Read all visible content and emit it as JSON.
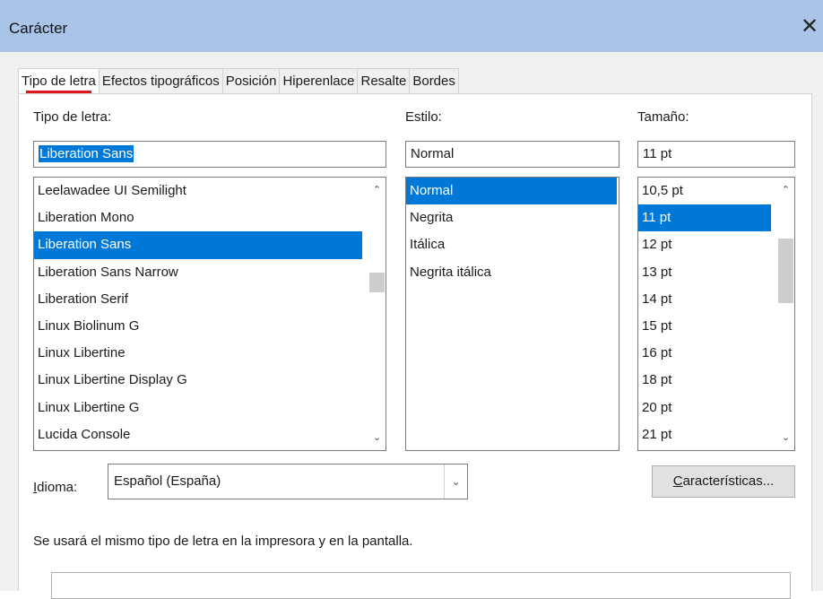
{
  "window": {
    "title": "Carácter",
    "close_label": "✕"
  },
  "tabs": [
    {
      "label": "Tipo de letra",
      "active": true
    },
    {
      "label": "Efectos tipográficos",
      "active": false
    },
    {
      "label": "Posición",
      "active": false
    },
    {
      "label": "Hiperenlace",
      "active": false
    },
    {
      "label": "Resalte",
      "active": false
    },
    {
      "label": "Bordes",
      "active": false
    }
  ],
  "font": {
    "label": "Tipo de letra:",
    "value": "Liberation Sans",
    "items": [
      "Leelawadee UI Semilight",
      "Liberation Mono",
      "Liberation Sans",
      "Liberation Sans Narrow",
      "Liberation Serif",
      "Linux Biolinum G",
      "Linux Libertine",
      "Linux Libertine Display G",
      "Linux Libertine G",
      "Lucida Console"
    ],
    "selected": "Liberation Sans"
  },
  "style": {
    "label": "Estilo:",
    "value": "Normal",
    "items": [
      "Normal",
      "Negrita",
      "Itálica",
      "Negrita itálica"
    ],
    "selected": "Normal"
  },
  "size": {
    "label": "Tamaño:",
    "value": "11 pt",
    "items": [
      "10,5 pt",
      "11 pt",
      "12 pt",
      "13 pt",
      "14 pt",
      "15 pt",
      "16 pt",
      "18 pt",
      "20 pt",
      "21 pt"
    ],
    "selected": "11 pt"
  },
  "language": {
    "label_mnemonic": "I",
    "label_rest": "dioma:",
    "value": "Español (España)"
  },
  "features_button": {
    "label_mnemonic": "C",
    "label_rest": "aracterísticas..."
  },
  "preview_note": "Se usará el mismo tipo de letra en la impresora y en la pantalla.",
  "colors": {
    "titlebar": "#a9c4e6",
    "selection": "#0078d7",
    "active_tab_underline": "#e0151c"
  }
}
